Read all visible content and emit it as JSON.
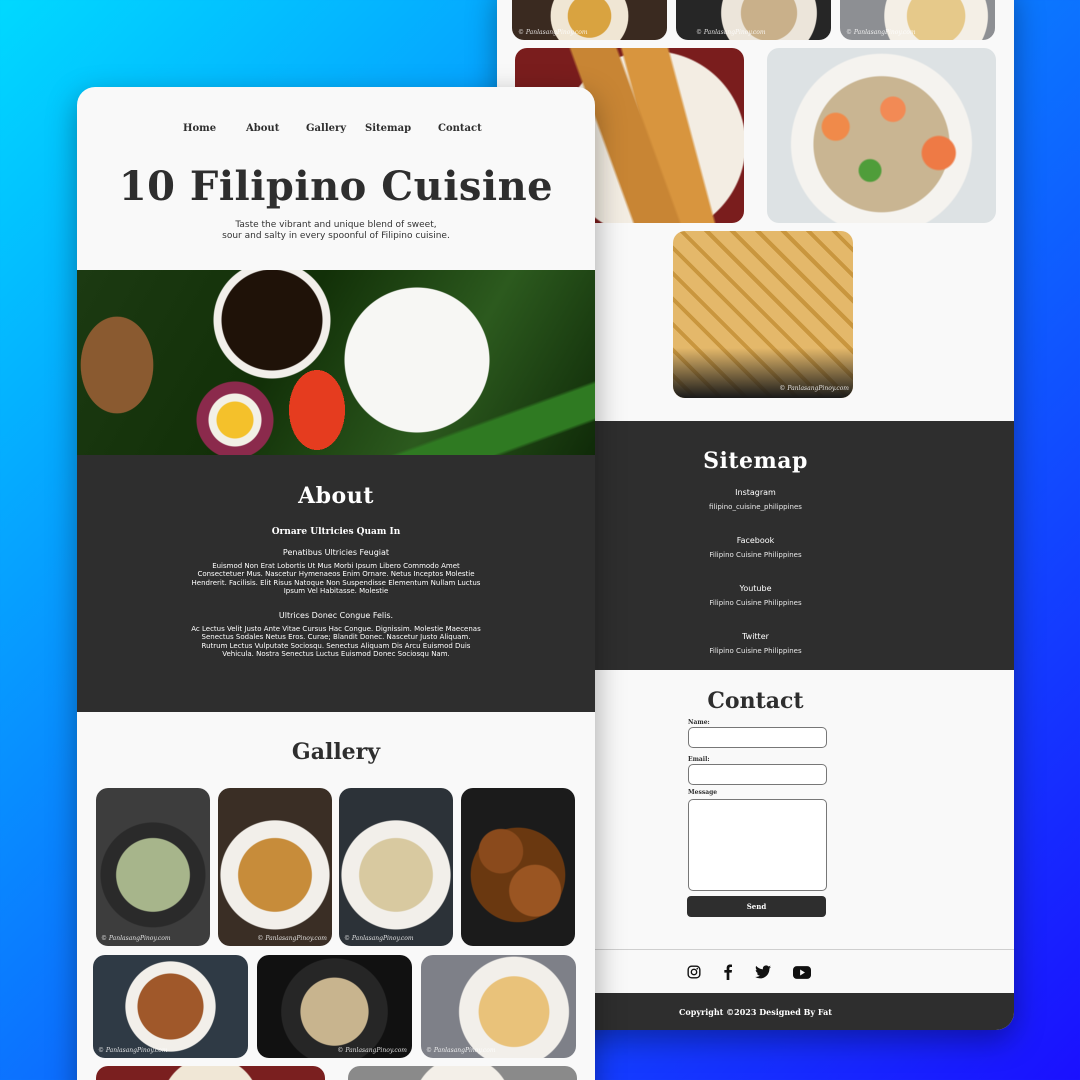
{
  "nav": {
    "items": [
      "Home",
      "About",
      "Gallery",
      "Sitemap",
      "Contact"
    ]
  },
  "hero": {
    "title": "10 Filipino Cuisine",
    "subtitle_line1": "Taste the vibrant and unique blend of sweet,",
    "subtitle_line2": "sour and salty in every spoonful of Filipino cuisine."
  },
  "about": {
    "title": "About",
    "heading": "Ornare Ultricies Quam In",
    "sub1": "Penatibus Ultricies Feugiat",
    "para1": "Euismod Non Erat Lobortis Ut Mus Morbi Ipsum Libero Commodo Amet Consectetuer Mus. Nascetur Hymenaeos Enim Ornare. Netus Inceptos Molestie Hendrerit.  Facilisis. Elit Risus Natoque Non Suspendisse Elementum Nullam Luctus Ipsum Vel Habitasse. Molestie",
    "sub2": "Ultrices Donec Congue Felis.",
    "para2": "Ac Lectus Velit Justo Ante Vitae Cursus Hac Congue. Dignissim. Molestie Maecenas Senectus Sodales Netus Eros. Curae; Blandit Donec. Nascetur Justo Aliquam. Rutrum Lectus Vulputate Sociosqu. Senectus Aliquam Dis Arcu Euismod Duis Vehicula. Nostra Senectus Luctus Euismod Donec Sociosqu Nam."
  },
  "gallery": {
    "title": "Gallery",
    "watermark": "© PanlasangPinoy.com"
  },
  "sitemap": {
    "title": "Sitemap",
    "links": [
      {
        "name": "Instagram",
        "handle": "filipino_cuisine_philippines"
      },
      {
        "name": "Facebook",
        "handle": "Filipino Cuisine Philippines"
      },
      {
        "name": "Youtube",
        "handle": "Filipino Cuisine Philippines"
      },
      {
        "name": "Twitter",
        "handle": "Filipino Cuisine Philippines"
      }
    ]
  },
  "contact": {
    "title": "Contact",
    "name_label": "Name:",
    "email_label": "Email:",
    "message_label": "Message",
    "send_label": "Send"
  },
  "footer": {
    "social_icons": [
      "instagram-icon",
      "facebook-icon",
      "twitter-icon",
      "youtube-icon"
    ],
    "copyright": "Copyright ©2023 Designed By Fat"
  },
  "colors": {
    "dark": "#2e2e2e",
    "page": "#f9f9f9",
    "background_start": "#00d9ff",
    "background_end": "#1a10ff"
  }
}
